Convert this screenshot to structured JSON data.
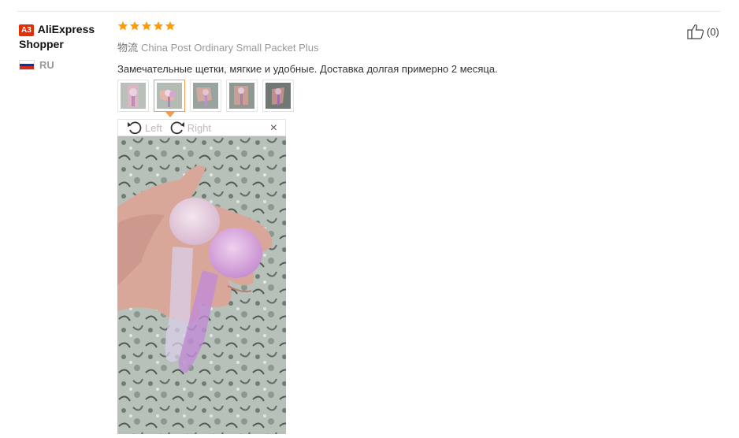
{
  "user": {
    "badge": "A3",
    "name_line1": "AliExpress",
    "name_line2": "Shopper",
    "country_code": "RU"
  },
  "review": {
    "rating": 5,
    "logistics_label": "物流",
    "logistics_value": "China Post Ordinary Small Packet Plus",
    "text": "Замечательные щетки, мягкие и удобные. Доставка долгая примерно 2 месяца.",
    "helpful_count": "(0)"
  },
  "viewer": {
    "rotate_left": "Left",
    "rotate_right": "Right",
    "close": "×",
    "thumbnails": 5,
    "active_thumbnail": 2
  },
  "colors": {
    "star": "#ff9a00",
    "badge": "#e62e04",
    "active_border": "#f39b4f"
  }
}
